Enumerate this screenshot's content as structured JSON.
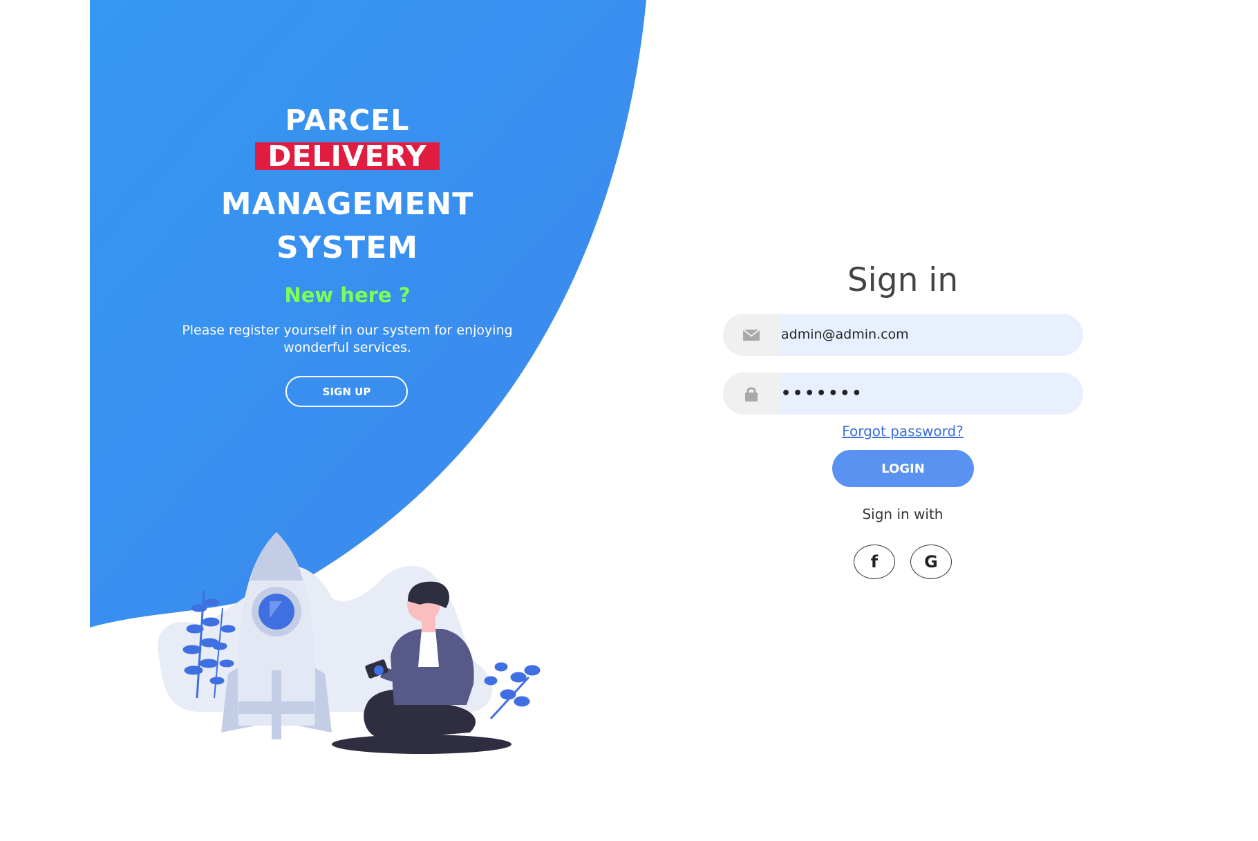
{
  "branding": {
    "line1": "PARCEL",
    "line2": "DELIVERY",
    "line3": "MANAGEMENT",
    "line4": "SYSTEM"
  },
  "promo": {
    "heading": "New here ?",
    "text": "Please register yourself in our system for enjoying wonderful services.",
    "signup_label": "SIGN UP"
  },
  "signin": {
    "title": "Sign in",
    "email_value": "admin@admin.com",
    "password_value": "•••••••",
    "forgot_label": "Forgot password?",
    "login_label": "LOGIN",
    "social_label": "Sign in with",
    "facebook_glyph": "f",
    "google_glyph": "G"
  },
  "colors": {
    "panel_blue": "#3a8bf0",
    "delivery_red": "#e01d40",
    "new_here_green": "#7eff55",
    "login_blue": "#5a92f1",
    "input_bg": "#e8f0fe"
  },
  "icons": {
    "email": "envelope-icon",
    "password": "lock-icon",
    "facebook": "facebook-icon",
    "google": "google-icon"
  }
}
